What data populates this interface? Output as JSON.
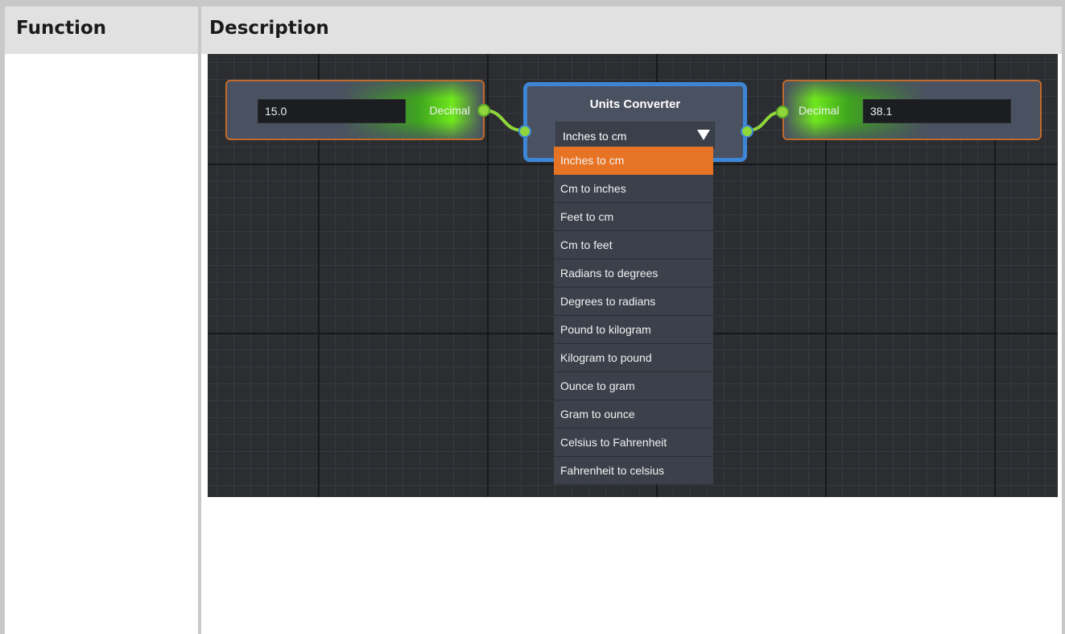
{
  "table": {
    "header_function": "Function",
    "header_description": "Description"
  },
  "graph": {
    "input_node": {
      "value": "15.0",
      "port_label": "Decimal"
    },
    "converter_node": {
      "title": "Units Converter",
      "selected": "Inches to cm",
      "options": [
        "Inches to cm",
        "Cm to inches",
        "Feet to cm",
        "Cm to feet",
        "Radians to degrees",
        "Degrees to radians",
        "Pound to kilogram",
        "Kilogram to pound",
        "Ounce to gram",
        "Gram to ounce",
        "Celsius to Fahrenheit",
        "Fahrenheit to celsius"
      ],
      "highlight_color": "#e77425",
      "selection_border_color": "#3d86d6"
    },
    "output_node": {
      "value": "38.1",
      "port_label": "Decimal"
    },
    "wire_color": "#8fd63a"
  }
}
